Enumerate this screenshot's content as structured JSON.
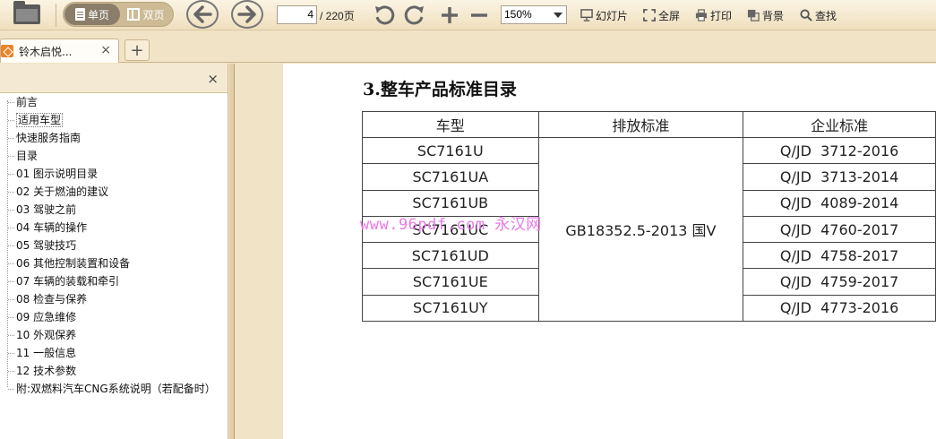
{
  "toolbar": {
    "view_single_label": "单页",
    "view_double_label": "双页",
    "current_page": "4",
    "total_pages": "/ 220页",
    "zoom_value": "150%",
    "slideshow_label": "幻灯片",
    "fullscreen_label": "全屏",
    "print_label": "打印",
    "background_label": "背景",
    "search_label": "查找"
  },
  "tabs": {
    "active_title": "铃木启悦...",
    "close_glyph": "×",
    "add_glyph": "+"
  },
  "sidebar": {
    "close_glyph": "×",
    "items": [
      "前言",
      "适用车型",
      "快速服务指南",
      "目录",
      "01 图示说明目录",
      "02 关于燃油的建议",
      "03 驾驶之前",
      "04 车辆的操作",
      "05 驾驶技巧",
      "06 其他控制装置和设备",
      "07 车辆的装载和牵引",
      "08 检查与保养",
      "09 应急维修",
      "10 外观保养",
      "11 一般信息",
      "12 技术参数",
      "附:双燃料汽车CNG系统说明（若配备时）"
    ],
    "selected_index": 1
  },
  "document": {
    "section_title": "3.整车产品标准目录",
    "table": {
      "headers": [
        "车型",
        "排放标准",
        "企业标准"
      ],
      "emission_standard": "GB18352.5-2013 国Ⅴ",
      "rows": [
        {
          "model": "SC7161U",
          "enterprise": "Q/JD  3712-2016"
        },
        {
          "model": "SC7161UA",
          "enterprise": "Q/JD  3713-2014"
        },
        {
          "model": "SC7161UB",
          "enterprise": "Q/JD  4089-2014"
        },
        {
          "model": "SC7161UC",
          "enterprise": "Q/JD  4760-2017"
        },
        {
          "model": "SC7161UD",
          "enterprise": "Q/JD  4758-2017"
        },
        {
          "model": "SC7161UE",
          "enterprise": "Q/JD  4759-2017"
        },
        {
          "model": "SC7161UY",
          "enterprise": "Q/JD  4773-2016"
        }
      ]
    },
    "watermark": "www.96pdf.com 永汉网"
  },
  "colors": {
    "toolbar_bg": "#efdfbd",
    "viewer_bg": "#f1e3c6",
    "watermark": "#e879e8",
    "tab_icon": "#e8842a"
  }
}
